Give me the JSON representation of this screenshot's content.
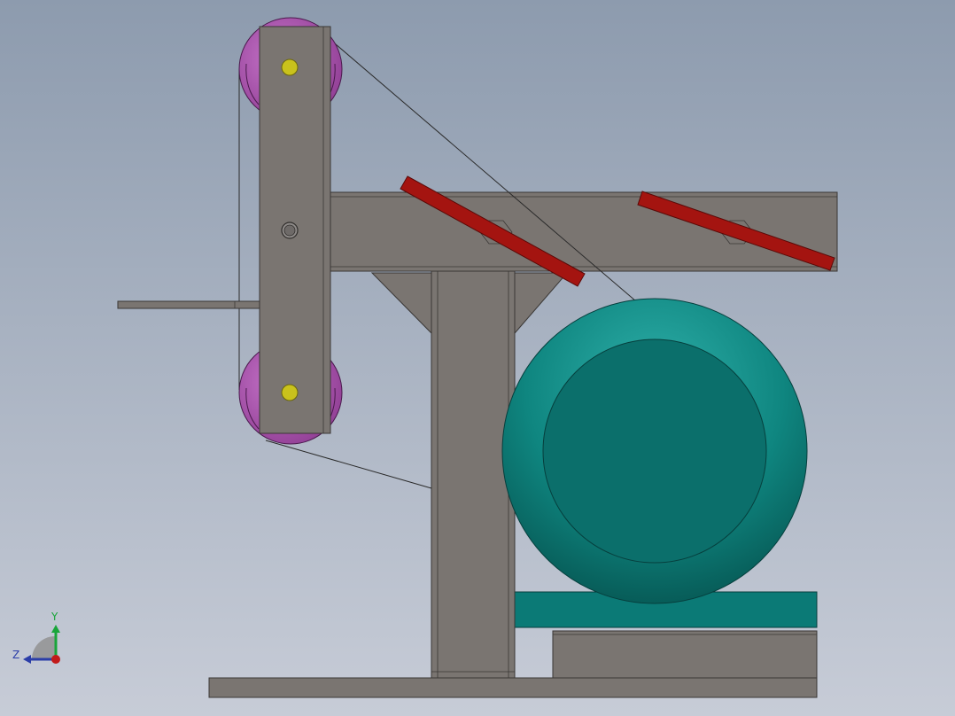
{
  "viewport": {
    "background_top": "#8d9bae",
    "background_bottom": "#c7ccd7"
  },
  "colors": {
    "steel": "#7a7571",
    "steel_stroke": "#3a3735",
    "pulley": "#b05cb4",
    "bolt": "#c9c21c",
    "motor": "#0b7a76",
    "motor_highlight": "#2aa6a0",
    "tool_rest": "#a41410",
    "belt": "#2a2a2a"
  },
  "triad": {
    "y_label": "Y",
    "z_label": "Z",
    "y_color": "#19a53a",
    "z_color": "#2b3ea8",
    "x_color": "#c21a1a",
    "icon": "axis-triad-icon"
  }
}
